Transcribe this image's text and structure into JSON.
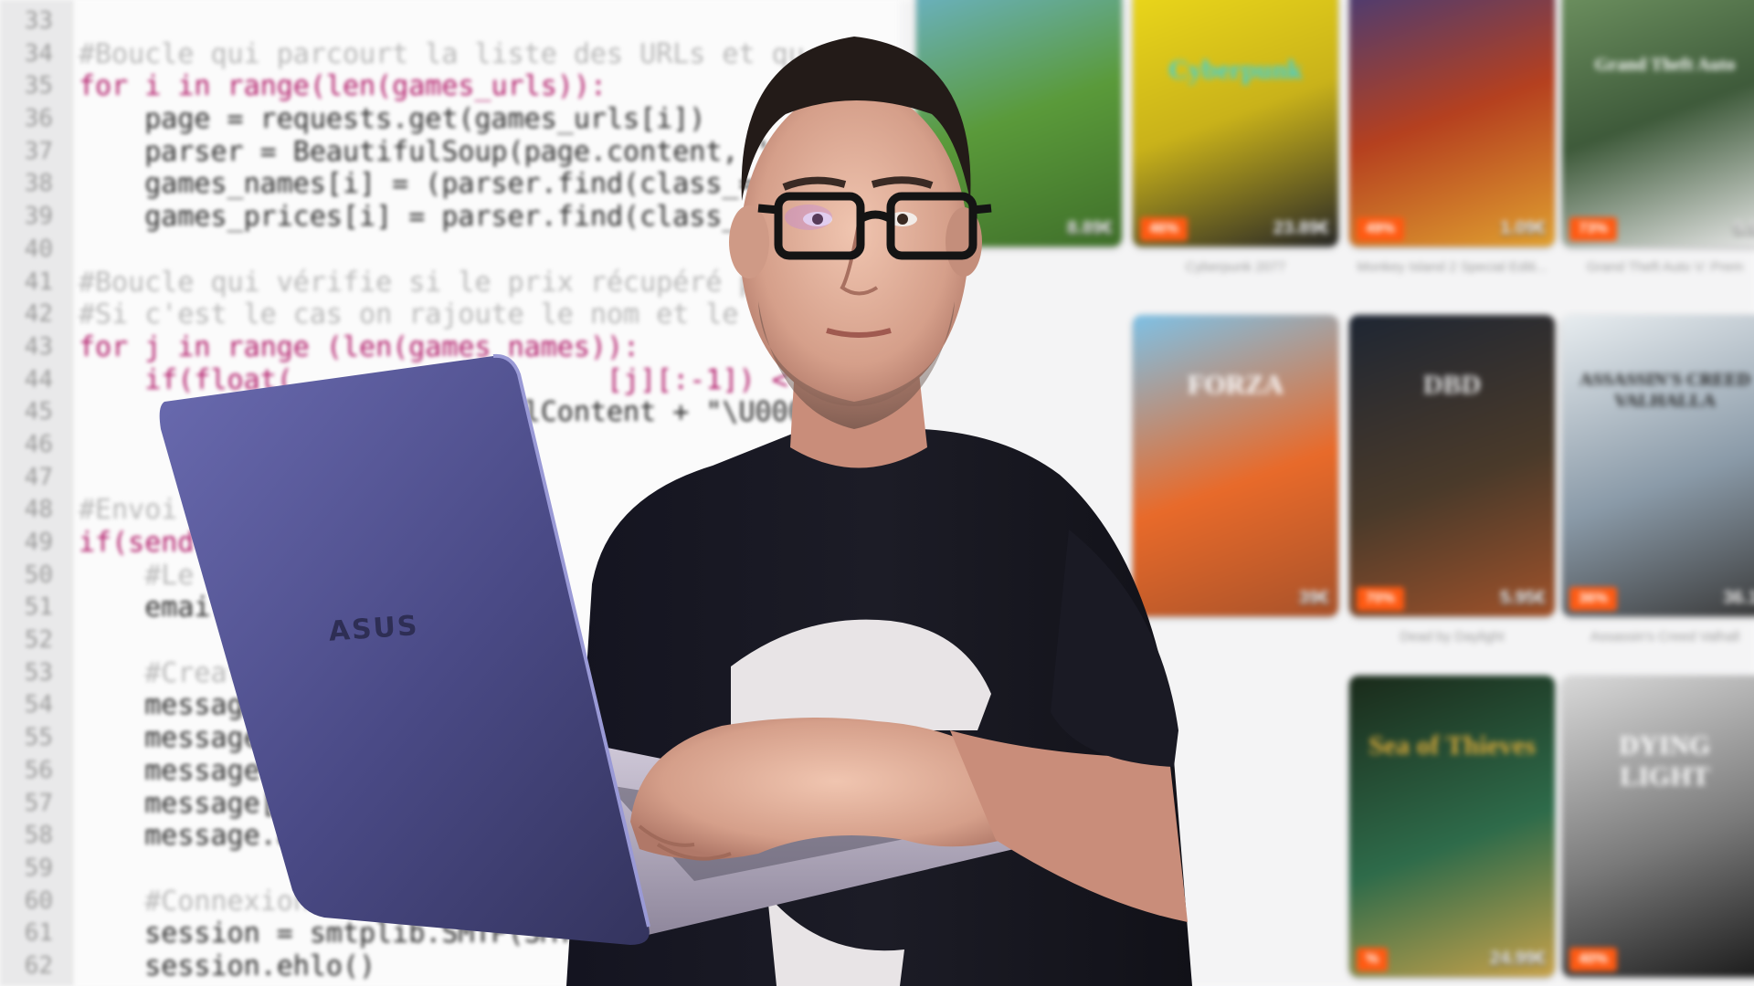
{
  "code": {
    "lines": [
      {
        "n": "33",
        "t": "",
        "k": "plain"
      },
      {
        "n": "34",
        "t": "#Boucle qui parcourt la liste des URLs et qu",
        "k": "comment"
      },
      {
        "n": "35",
        "t": "for i in range(len(games_urls)):",
        "k": "kw"
      },
      {
        "n": "36",
        "t": "    page = requests.get(games_urls[i])",
        "k": "plain"
      },
      {
        "n": "37",
        "t": "    parser = BeautifulSoup(page.content, '",
        "k": "plain"
      },
      {
        "n": "38",
        "t": "    games_names[i] = (parser.find(class_=",
        "k": "plain"
      },
      {
        "n": "39",
        "t": "    games_prices[i] = parser.find(class_=",
        "k": "plain"
      },
      {
        "n": "40",
        "t": "",
        "k": "plain"
      },
      {
        "n": "41",
        "t": "#Boucle qui vérifie si le prix récupéré p",
        "k": "comment"
      },
      {
        "n": "42",
        "t": "#Si c'est le cas on rajoute le nom et le p",
        "k": "comment"
      },
      {
        "n": "43",
        "t": "for j in range (len(games_names)):",
        "k": "kw"
      },
      {
        "n": "44",
        "t": "    if(float(                   [j][:-1]) < prices",
        "k": "kw"
      },
      {
        "n": "45",
        "t": "                        mailContent + \"\\U000",
        "k": "plain"
      },
      {
        "n": "46",
        "t": "",
        "k": "plain"
      },
      {
        "n": "47",
        "t": "",
        "k": "plain"
      },
      {
        "n": "48",
        "t": "#Envoi",
        "k": "comment"
      },
      {
        "n": "49",
        "t": "if(send",
        "k": "kw"
      },
      {
        "n": "50",
        "t": "    #Le",
        "k": "comment"
      },
      {
        "n": "51",
        "t": "    email",
        "k": "plain"
      },
      {
        "n": "52",
        "t": "",
        "k": "plain"
      },
      {
        "n": "53",
        "t": "    #Creat",
        "k": "comment"
      },
      {
        "n": "54",
        "t": "    message",
        "k": "plain"
      },
      {
        "n": "55",
        "t": "    message",
        "k": "plain"
      },
      {
        "n": "56",
        "t": "    message",
        "k": "plain"
      },
      {
        "n": "57",
        "t": "    message[",
        "k": "plain"
      },
      {
        "n": "58",
        "t": "    message.attach(",
        "k": "plain"
      },
      {
        "n": "59",
        "t": "",
        "k": "plain"
      },
      {
        "n": "60",
        "t": "    #Connexion  au serveur",
        "k": "comment"
      },
      {
        "n": "61",
        "t": "    session = smtplib.SMTP(SMTP_",
        "k": "plain"
      },
      {
        "n": "62",
        "t": "    session.ehlo()",
        "k": "plain"
      }
    ]
  },
  "store": {
    "tiles": [
      {
        "id": "minecraft",
        "badge": "",
        "price": "8.89€",
        "caption": "",
        "colors": [
          "#6fb8e8",
          "#5a9a3a",
          "#3f6f2a"
        ],
        "logo": "",
        "logo_color": "#ffffff"
      },
      {
        "id": "cyberpunk",
        "badge": "46%",
        "price": "23.89€",
        "caption": "Cyberpunk 2077",
        "colors": [
          "#f4e11a",
          "#c9b21a",
          "#262626"
        ],
        "logo": "Cyberpunk",
        "logo_color": "#38d3e0"
      },
      {
        "id": "monkey-island",
        "badge": "49%",
        "price": "1.09€",
        "caption": "Monkey Island 2 Special Editi...",
        "colors": [
          "#2d3b8a",
          "#b5401f",
          "#e0a030"
        ],
        "logo": "",
        "logo_color": "#ffffff"
      },
      {
        "id": "gta5",
        "badge": "73%",
        "price": "9.9",
        "caption": "Grand Theft Auto V: Prem",
        "colors": [
          "#7aa06a",
          "#3e5a3a",
          "#e8e8e8"
        ],
        "logo": "Grand Theft Auto",
        "logo_color": "#ffffff"
      },
      {
        "id": "forza",
        "badge": "",
        "price": "39€",
        "caption": "",
        "colors": [
          "#7ec1e6",
          "#e86a2a",
          "#a8522a"
        ],
        "logo": "FORZA",
        "logo_color": "#ffffff"
      },
      {
        "id": "dead-by-daylight",
        "badge": "70%",
        "price": "5.95€",
        "caption": "Dead by Daylight",
        "colors": [
          "#1e2633",
          "#4a3a2a",
          "#a0522a"
        ],
        "logo": "DBD",
        "logo_color": "#e8e8e8"
      },
      {
        "id": "valhalla",
        "badge": "36%",
        "price": "36.1",
        "caption": "Assassin's Creed Valhall",
        "colors": [
          "#e8edf0",
          "#8a9aa8",
          "#3a3a3a"
        ],
        "logo": "ASSASSIN'S CREED VALHALLA",
        "logo_color": "#222222"
      },
      {
        "id": "sea-of-thieves",
        "badge": "%",
        "price": "24.99€",
        "caption": "",
        "colors": [
          "#1a2a1a",
          "#2e6b4a",
          "#c8a24a"
        ],
        "logo": "Sea of Thieves",
        "logo_color": "#d9a93a"
      },
      {
        "id": "dying-light",
        "badge": "40%",
        "price": "",
        "caption": "",
        "colors": [
          "#d9d9d9",
          "#7a7a7a",
          "#1a1a1a"
        ],
        "logo": "DYING LIGHT",
        "logo_color": "#ffffff"
      }
    ]
  },
  "laptop": {
    "brand": "ASUS"
  }
}
